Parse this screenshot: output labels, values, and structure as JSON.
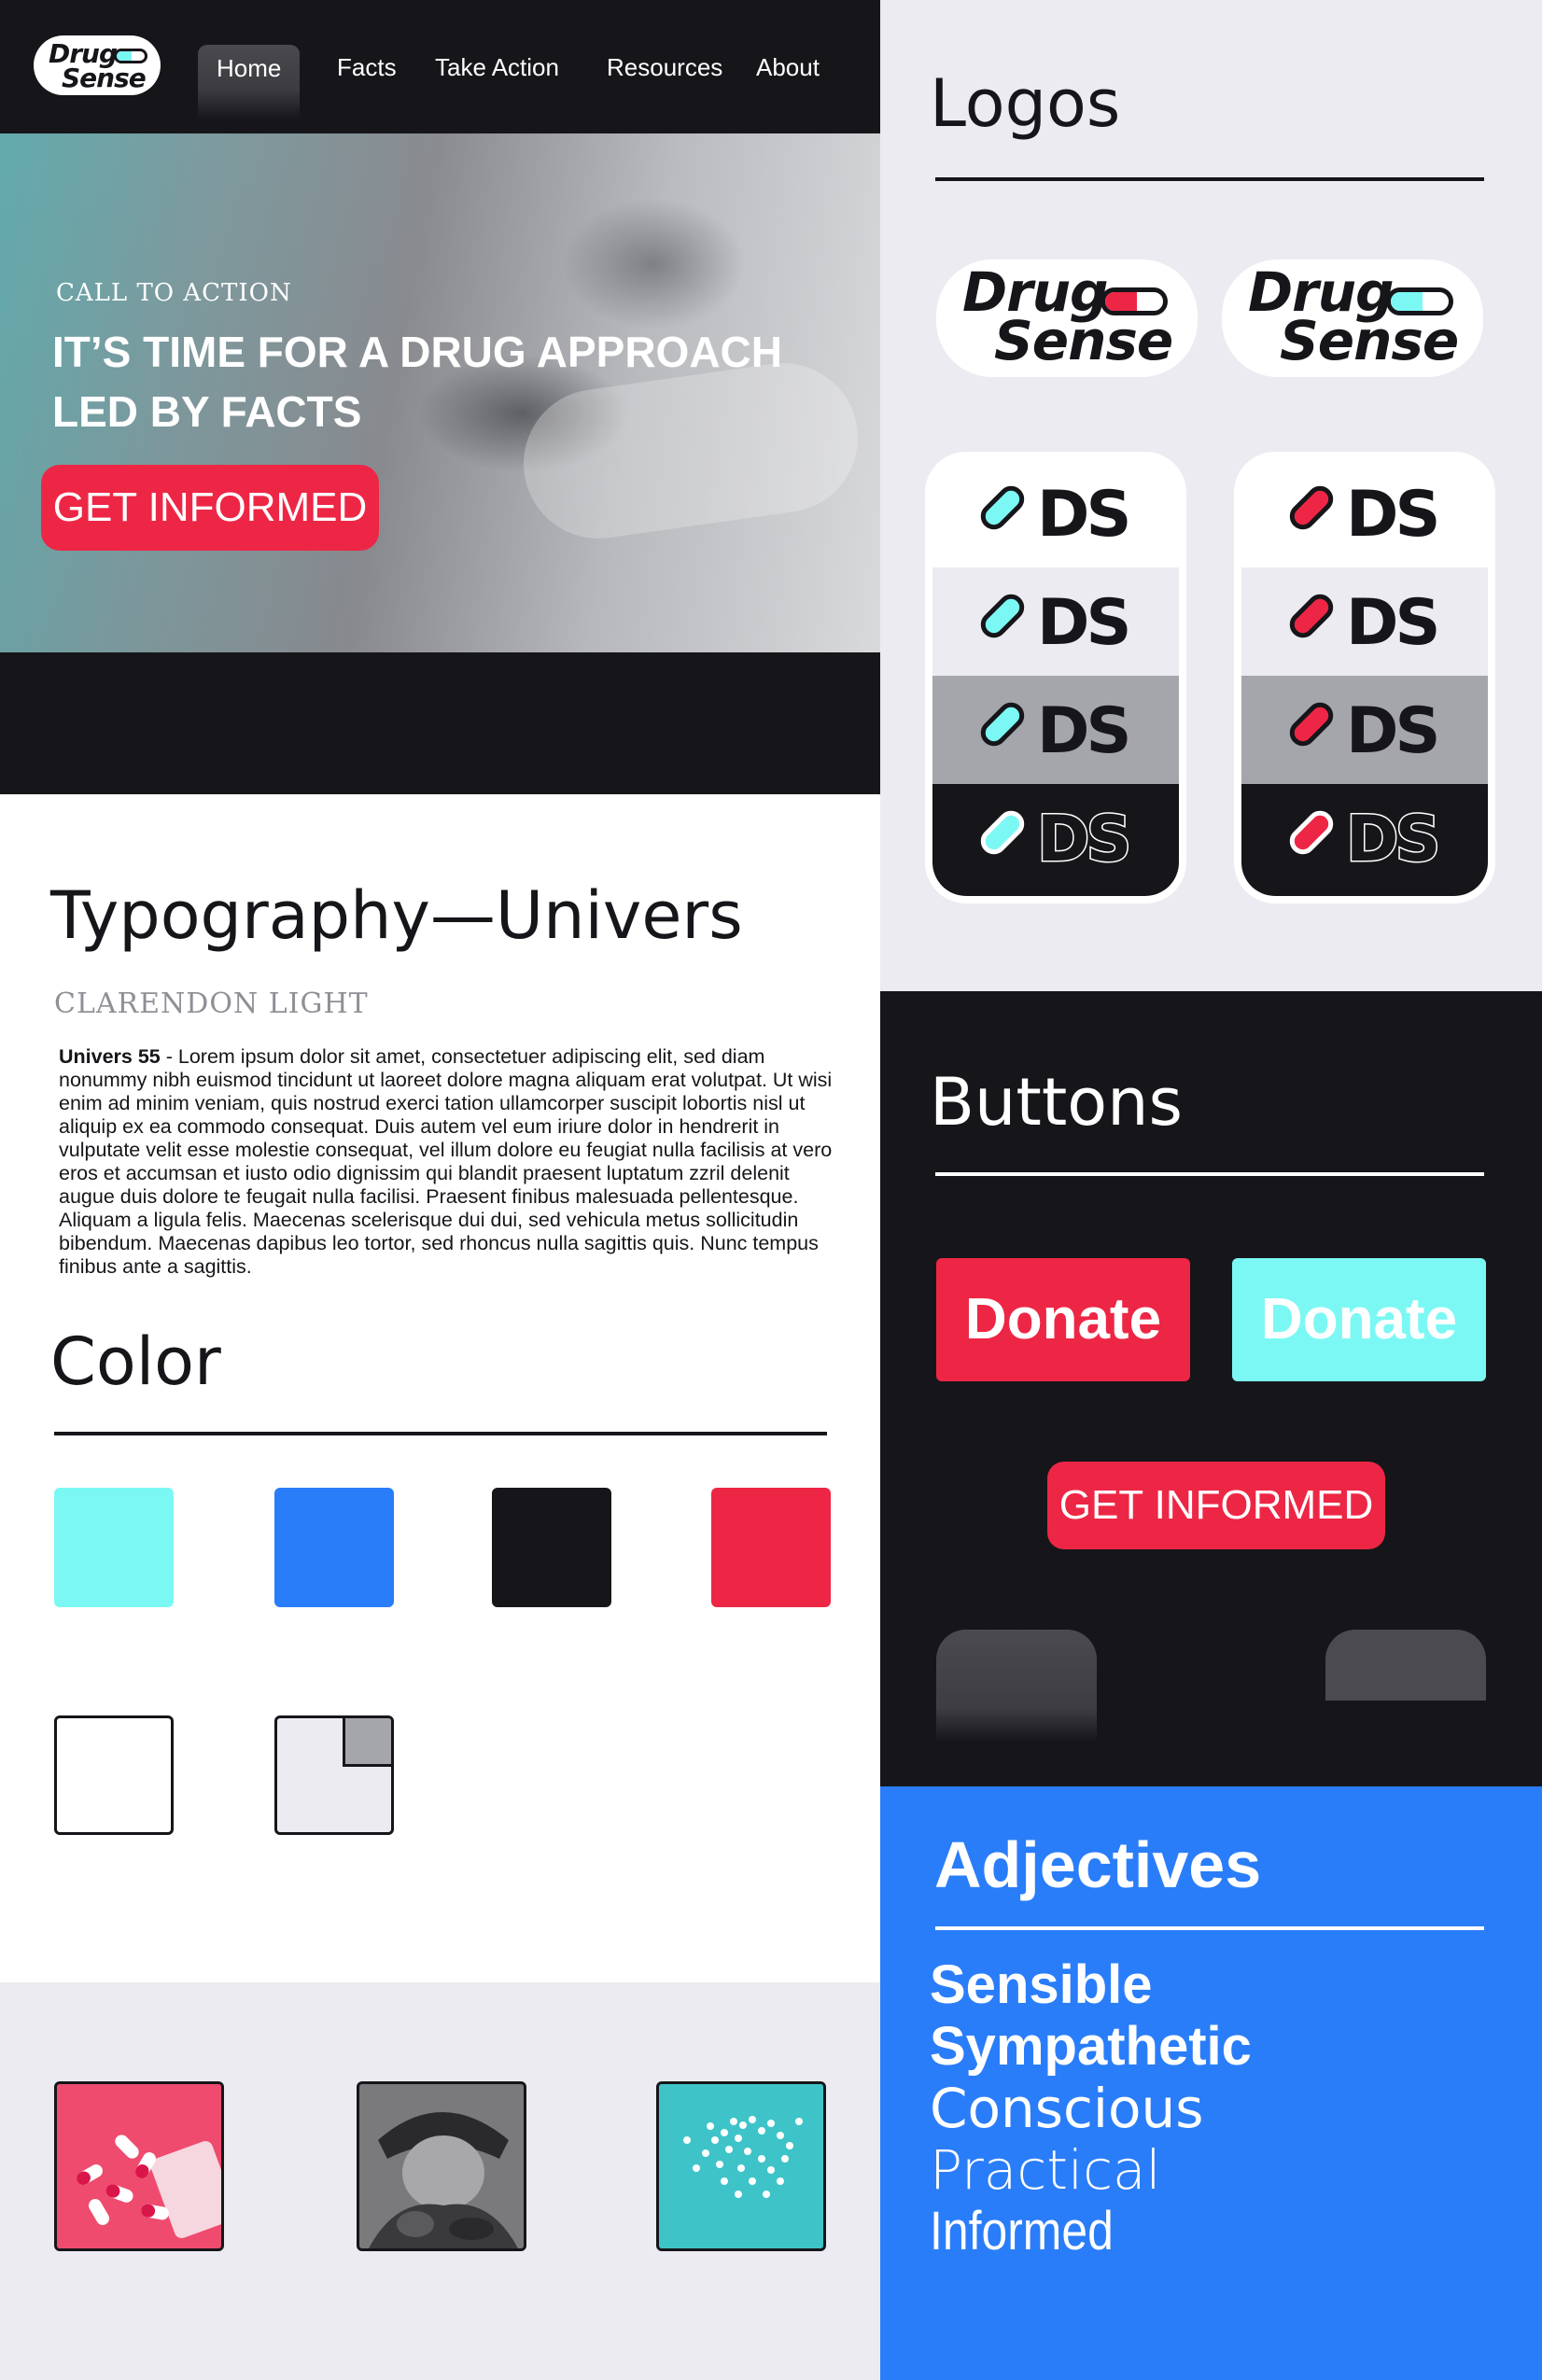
{
  "brand": {
    "name_line1": "Drug",
    "name_line2": "Sense",
    "monogram": "DS",
    "colors": {
      "cyan": "#7cf8f4",
      "blue": "#2a7df9",
      "black": "#16161a",
      "red": "#ee2645",
      "white": "#ffffff",
      "light_gray": "#ecebf1",
      "mid_gray": "#a4a6ab"
    }
  },
  "nav": {
    "items": [
      {
        "label": "Home",
        "active": true
      },
      {
        "label": "Facts",
        "active": false
      },
      {
        "label": "Take Action",
        "active": false
      },
      {
        "label": "Resources",
        "active": false
      },
      {
        "label": "About",
        "active": false
      }
    ]
  },
  "hero": {
    "eyebrow": "CALL TO ACTION",
    "title_line1": "IT’S TIME FOR A DRUG APPROACH",
    "title_line2": "LED BY FACTS",
    "button": "GET INFORMED"
  },
  "typography": {
    "title": "Typography—Univers",
    "subtitle": "CLARENDON LIGHT",
    "body_label": "Univers 55",
    "body_text": " - Lorem ipsum dolor sit amet, consectetuer adipiscing elit, sed diam nonummy nibh euismod tincidunt ut laoreet dolore magna aliquam erat volutpat. Ut wisi enim ad minim veniam, quis nostrud exerci tation ullamcorper suscipit lobortis nisl ut aliquip ex ea commodo consequat. Duis autem vel eum iriure dolor in hendrerit in vulputate velit esse molestie consequat, vel illum dolore eu feugiat nulla facilisis at vero eros et accumsan et iusto odio dignissim qui blandit praesent luptatum zzril delenit augue duis dolore te feugait nulla facilisi. Praesent finibus malesuada pellentesque. Aliquam a ligula felis. Maecenas scelerisque dui dui, sed vehicula metus sollicitudin bibendum. Maecenas dapibus leo tortor, sed rhoncus nulla sagittis quis. Nunc tempus finibus ante a sagittis."
  },
  "color_section": {
    "title": "Color",
    "swatches": [
      "#7cf8f4",
      "#2a7df9",
      "#16161a",
      "#ee2645",
      "#ffffff",
      "#ecebf1"
    ]
  },
  "logos_section": {
    "title": "Logos"
  },
  "buttons_section": {
    "title": "Buttons",
    "donate_red": "Donate",
    "donate_cyan": "Donate",
    "get_informed": "GET INFORMED"
  },
  "adjectives_section": {
    "title": "Adjectives",
    "items": [
      "Sensible",
      "Sympathetic",
      "Conscious",
      "Practical",
      "Informed"
    ]
  }
}
